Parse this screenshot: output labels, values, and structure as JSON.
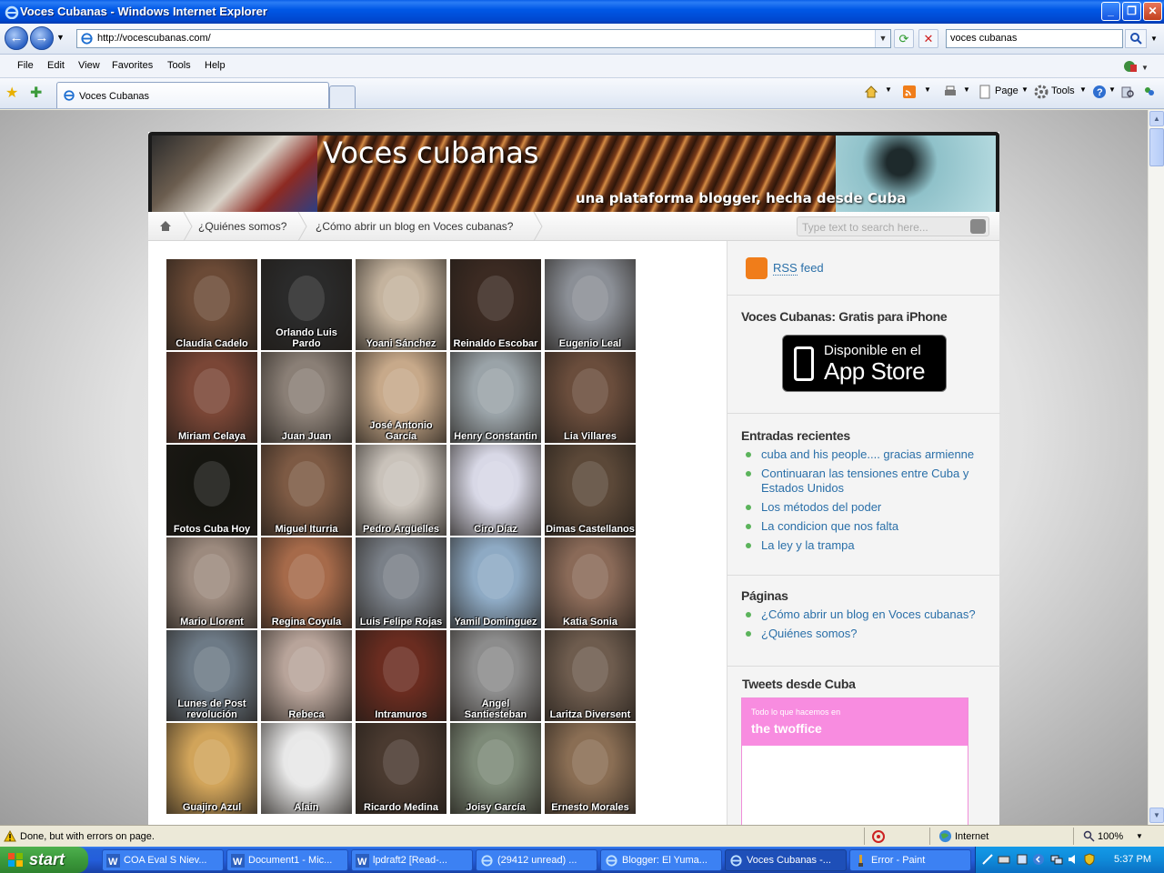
{
  "window": {
    "title": "Voces Cubanas - Windows Internet Explorer"
  },
  "address": {
    "url": "http://vocescubanas.com/",
    "search_value": "voces cubanas"
  },
  "menu": [
    "File",
    "Edit",
    "View",
    "Favorites",
    "Tools",
    "Help"
  ],
  "tab": {
    "label": "Voces Cubanas"
  },
  "commandbar": {
    "page_label": "Page",
    "tools_label": "Tools"
  },
  "site": {
    "title": "Voces cubanas",
    "tagline": "una plataforma blogger, hecha desde Cuba",
    "nav": [
      "¿Quiénes somos?",
      "¿Cómo abrir un blog en Voces cubanas?"
    ],
    "search_placeholder": "Type text to search here..."
  },
  "bloggers": [
    {
      "name": "Claudia Cadelo",
      "color": "#6b4a36"
    },
    {
      "name": "Orlando Luis Pardo",
      "color": "#2a2a2a"
    },
    {
      "name": "Yoani Sánchez",
      "color": "#c4b39e"
    },
    {
      "name": "Reinaldo Escobar",
      "color": "#3b2a22"
    },
    {
      "name": "Eugenio Leal",
      "color": "#8b8f96"
    },
    {
      "name": "Miriam Celaya",
      "color": "#7a4636"
    },
    {
      "name": "Juan Juan",
      "color": "#8a7f76"
    },
    {
      "name": "José Antonio García",
      "color": "#c7a98a"
    },
    {
      "name": "Henry Constantin",
      "color": "#9aa3a8"
    },
    {
      "name": "Lia Villares",
      "color": "#6a4d3c"
    },
    {
      "name": "Fotos Cuba Hoy",
      "color": "#151510"
    },
    {
      "name": "Miguel Iturria",
      "color": "#7d5a44"
    },
    {
      "name": "Pedro Argüelles",
      "color": "#c9c2ba"
    },
    {
      "name": "Ciro Díaz",
      "color": "#d8d8e6"
    },
    {
      "name": "Dimas Castellanos",
      "color": "#5b4838"
    },
    {
      "name": "Mario Llorent",
      "color": "#9c8a7e"
    },
    {
      "name": "Regina Coyula",
      "color": "#a66a4a"
    },
    {
      "name": "Luis Felipe Rojas",
      "color": "#7a8088"
    },
    {
      "name": "Yamil Dominguez",
      "color": "#8eaac4"
    },
    {
      "name": "Katia Sonia",
      "color": "#8a6a58"
    },
    {
      "name": "Lunes de Post revolución",
      "color": "#6d7a86"
    },
    {
      "name": "Rebeca",
      "color": "#b8a49a"
    },
    {
      "name": "Intramuros",
      "color": "#6a2c20"
    },
    {
      "name": "Angel Santiesteban",
      "color": "#8c8c8c"
    },
    {
      "name": "Laritza Diversent",
      "color": "#6e5c4e"
    },
    {
      "name": "Guajiro Azul",
      "color": "#d1a45a"
    },
    {
      "name": "Alain",
      "color": "#e8e8e8"
    },
    {
      "name": "Ricardo Medina",
      "color": "#4a3a30"
    },
    {
      "name": "Joisy García",
      "color": "#7d8a78"
    },
    {
      "name": "Ernesto Morales",
      "color": "#8a6e54"
    }
  ],
  "sidebar": {
    "rss_prefix": "RSS",
    "rss_suffix": "feed",
    "iphone_heading": "Voces Cubanas: Gratis para iPhone",
    "appstore_line1": "Disponible en el",
    "appstore_line2": "App Store",
    "recent_heading": "Entradas recientes",
    "recent": [
      "cuba and his people.... gracias armienne",
      "Continuaran las tensiones entre Cuba y Estados Unidos",
      "Los métodos del poder",
      "La condicion que nos falta",
      "La ley y la trampa"
    ],
    "pages_heading": "Páginas",
    "pages": [
      "¿Cómo abrir un blog en Voces cubanas?",
      "¿Quiénes somos?"
    ],
    "tweets_heading": "Tweets desde Cuba",
    "tweets_small": "Todo lo que hacemos en",
    "tweets_big": "the twoffice"
  },
  "status": {
    "message": "Done, but with errors on page.",
    "zone": "Internet",
    "zoom": "100%"
  },
  "taskbar": {
    "start": "start",
    "tasks": [
      "COA Eval S Niev...",
      "Document1 - Mic...",
      "lpdraft2 [Read-...",
      "(29412 unread) ...",
      "Blogger: El Yuma...",
      "Voces Cubanas -...",
      "Error - Paint"
    ],
    "clock": "5:37 PM"
  }
}
